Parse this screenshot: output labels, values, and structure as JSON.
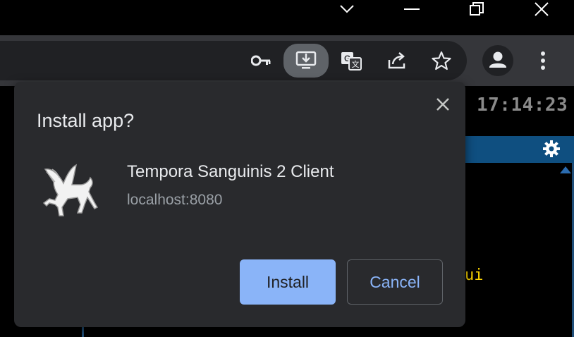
{
  "clock": {
    "time": "17:14:23"
  },
  "background_fragment": "ui",
  "window_controls": [
    "chevron-down-icon",
    "minimize-icon",
    "restore-icon",
    "close-icon"
  ],
  "toolbar_icons": [
    "key-icon",
    "install-app-icon",
    "translate-icon",
    "share-icon",
    "bookmark-star-icon",
    "profile-icon",
    "menu-icon"
  ],
  "dialog": {
    "title": "Install app?",
    "app_name": "Tempora Sanguinis 2 Client",
    "origin": "localhost:8080",
    "install_label": "Install",
    "cancel_label": "Cancel"
  },
  "colors": {
    "dialog_bg": "#292a2d",
    "accent": "#8ab4f8",
    "toolbar_bg": "#35363a",
    "panel_header": "#0f4f80"
  }
}
